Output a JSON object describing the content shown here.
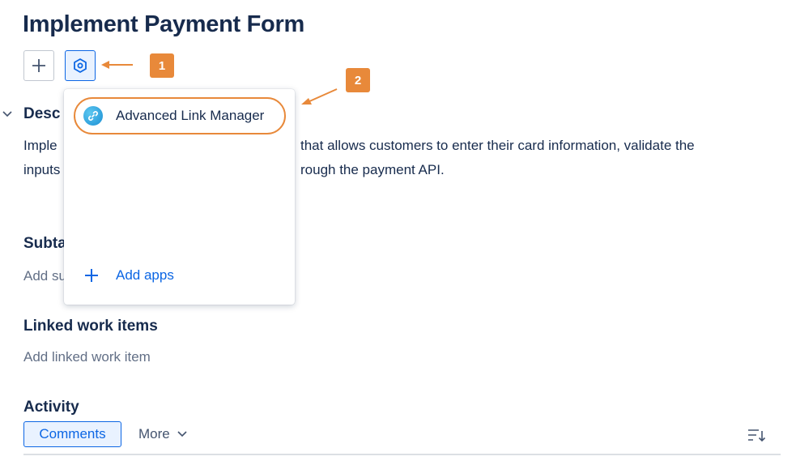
{
  "issue": {
    "title": "Implement Payment Form"
  },
  "toolbar": {
    "add_icon": "plus-icon",
    "apps_icon": "hexagon-apps-icon"
  },
  "annotations": [
    {
      "label": "1",
      "color": "#e8893a"
    },
    {
      "label": "2",
      "color": "#e8893a"
    }
  ],
  "description": {
    "heading": "Desc",
    "line1_start": "Imple",
    "line1_end": "that allows customers to enter their card information, validate the",
    "line2_start": "inputs",
    "line2_end": "rough the payment API."
  },
  "subtasks": {
    "heading": "Subta",
    "placeholder": "Add su"
  },
  "apps_menu": {
    "items": [
      {
        "label": "Advanced Link Manager",
        "icon": "link-icon"
      }
    ],
    "add_apps_label": "Add apps"
  },
  "linked": {
    "heading": "Linked work items",
    "placeholder": "Add linked work item"
  },
  "activity": {
    "heading": "Activity",
    "tabs": [
      {
        "label": "Comments",
        "selected": true
      },
      {
        "label": "More",
        "selected": false
      }
    ],
    "sort_icon": "sort-icon"
  },
  "colors": {
    "accent": "#0c66e4",
    "annotation": "#e8893a"
  }
}
